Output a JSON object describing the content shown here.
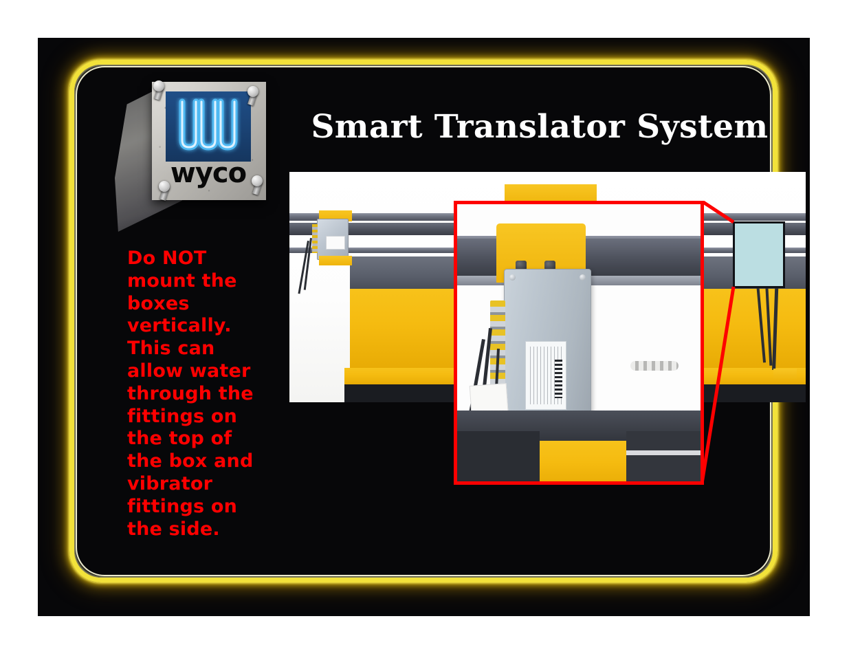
{
  "slide": {
    "title": "Smart Translator System",
    "background_color": "#070709",
    "frame_color": "#f2e23a",
    "warning_color": "#fe0000",
    "highlight_color": "#bbdee2"
  },
  "logo": {
    "brand": "wyco",
    "mark_letter": "W",
    "plate_color": "#1a4273",
    "bolt_count": 4
  },
  "warning": {
    "text": "Do NOT mount the boxes vertically. This can allow water through the fittings on the top of the box and vibrator fittings on the side."
  },
  "photo": {
    "alt": "Yellow concrete paver machine with gray translator control boxes mounted on the rails",
    "callout": {
      "border_color": "#fe0000",
      "alt": "Magnified view of a gray translator junction box mounted vertically on the yellow clamp bracket with cable fittings along its left side"
    },
    "highlight": {
      "fill": "#bbdee2",
      "border": "#111318",
      "alt": "Light blue rectangle masking the region the callout magnifies"
    },
    "leader_lines": {
      "color": "#fe0000",
      "count": 2
    }
  }
}
